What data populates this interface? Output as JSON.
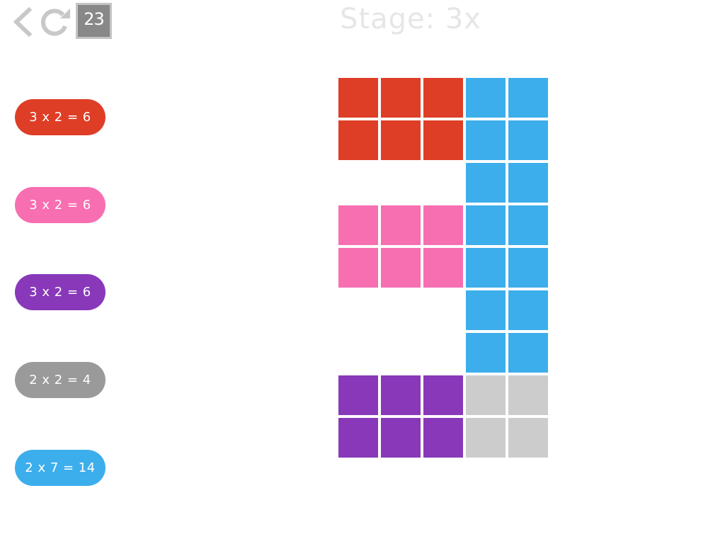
{
  "header": {
    "back_icon": "chevron-left-icon",
    "restart_icon": "restart-icon",
    "level": "23",
    "title": "Stage: 3x"
  },
  "colors": {
    "red": "#de3e26",
    "pink": "#f76eb1",
    "purple": "#8838b9",
    "gray": "#9a9a9a",
    "gray_cell": "#cccccc",
    "blue": "#3daeec",
    "icon": "#c8c8c8",
    "title": "#e6e6e6"
  },
  "equations": [
    {
      "label": "3 x 2 = 6",
      "color": "#de3e26"
    },
    {
      "label": "3 x 2 = 6",
      "color": "#f76eb1"
    },
    {
      "label": "3 x 2 = 6",
      "color": "#8838b9"
    },
    {
      "label": "2 x 2 = 4",
      "color": "#9a9a9a"
    },
    {
      "label": "2 x 7 = 14",
      "color": "#3daeec"
    }
  ],
  "grid": {
    "rows": [
      [
        "red",
        "red",
        "red",
        "blue",
        "blue"
      ],
      [
        "red",
        "red",
        "red",
        "blue",
        "blue"
      ],
      [
        "",
        "",
        "",
        "blue",
        "blue"
      ],
      [
        "pink",
        "pink",
        "pink",
        "blue",
        "blue"
      ],
      [
        "pink",
        "pink",
        "pink",
        "blue",
        "blue"
      ],
      [
        "",
        "",
        "",
        "blue",
        "blue"
      ],
      [
        "",
        "",
        "",
        "blue",
        "blue"
      ],
      [
        "purple",
        "purple",
        "purple",
        "gray",
        "gray"
      ],
      [
        "purple",
        "purple",
        "purple",
        "gray",
        "gray"
      ]
    ]
  }
}
